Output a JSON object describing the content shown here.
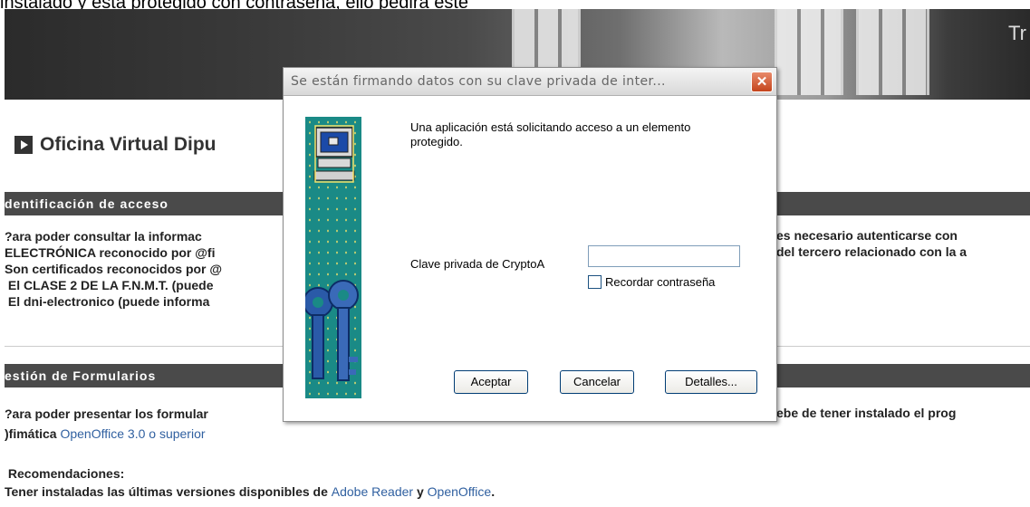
{
  "page": {
    "top_text": "instalado y está protegido con contraseña, ello pedirá este",
    "banner_text": "Tr",
    "title": "Oficina Virtual Dipu",
    "sections": {
      "acceso": {
        "heading": "dentificación de acceso",
        "lines": [
          "?ara poder consultar la informac",
          "ELECTRÓNICA reconocido por @fi",
          "Son certificados reconocidos por @",
          " El CLASE 2 DE LA F.N.M.T. (puede",
          " El dni-electronico (puede informa"
        ],
        "right_lines": [
          "es necesario autenticarse con",
          "del tercero relacionado con la a"
        ]
      },
      "formularios": {
        "heading": "estión de Formularios",
        "line1": "?ara poder presentar los formular",
        "line1_right": "ebe de tener instalado el prog",
        "line2_bold": ")fimática ",
        "line2_link": "OpenOffice 3.0 o superior"
      },
      "recomendaciones": {
        "heading": " Recomendaciones:",
        "line_prefix": "Tener instaladas las últimas versiones disponibles de ",
        "link1": "Adobe Reader",
        "mid": " y ",
        "link2": "OpenOffice",
        "end": "."
      }
    }
  },
  "dialog": {
    "title": "Se están firmando datos con su clave privada de inter...",
    "close_icon": "close-icon",
    "message": "Una aplicación está solicitando acceso a un elemento protegido.",
    "key_label": "Clave privada de CryptoA",
    "key_value": "",
    "remember_label": "Recordar contraseña",
    "remember_checked": false,
    "buttons": {
      "accept": "Aceptar",
      "cancel": "Cancelar",
      "details": "Detalles..."
    }
  }
}
